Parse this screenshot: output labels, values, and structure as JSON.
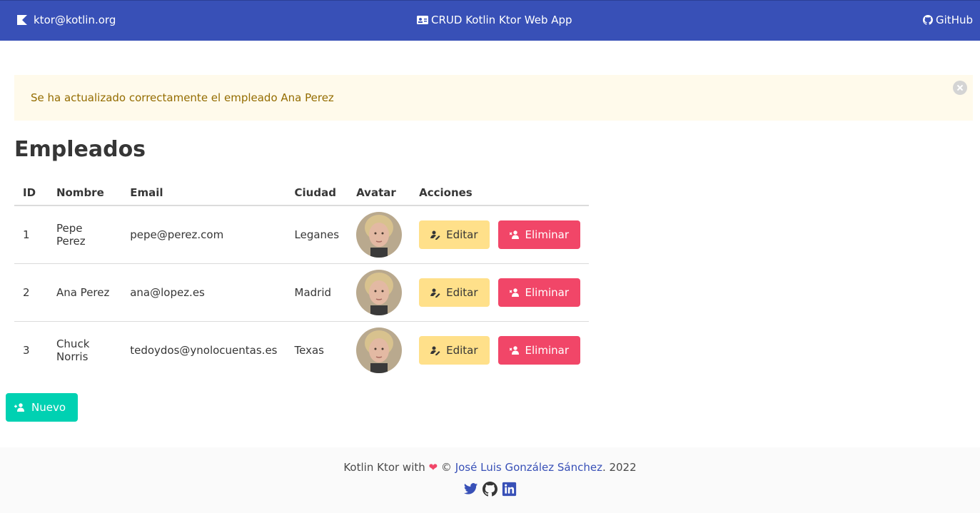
{
  "navbar": {
    "email": "ktor@kotlin.org",
    "title": "CRUD Kotlin Ktor Web App",
    "github": "GitHub",
    "color": "#3850b7"
  },
  "notification": {
    "message": "Se ha actualizado correctamente el empleado Ana Perez",
    "color": "#fffaeb"
  },
  "page": {
    "title": "Empleados"
  },
  "table": {
    "headers": [
      "ID",
      "Nombre",
      "Email",
      "Ciudad",
      "Avatar",
      "Acciones"
    ],
    "rows": [
      {
        "id": "1",
        "nombre": "Pepe Perez",
        "email": "pepe@perez.com",
        "ciudad": "Leganes",
        "edit": "Editar",
        "delete": "Eliminar"
      },
      {
        "id": "2",
        "nombre": "Ana Perez",
        "email": "ana@lopez.es",
        "ciudad": "Madrid",
        "edit": "Editar",
        "delete": "Eliminar"
      },
      {
        "id": "3",
        "nombre": "Chuck Norris",
        "email": "tedoydos@ynolocuentas.es",
        "ciudad": "Texas",
        "edit": "Editar",
        "delete": "Eliminar"
      }
    ]
  },
  "new_button": {
    "label": "Nuevo"
  },
  "footer": {
    "prefix": "Kotlin Ktor with",
    "copy": "©",
    "author": "José Luis González Sánchez",
    "year": ". 2022",
    "social": [
      "twitter-icon",
      "github-icon",
      "linkedin-icon"
    ]
  }
}
